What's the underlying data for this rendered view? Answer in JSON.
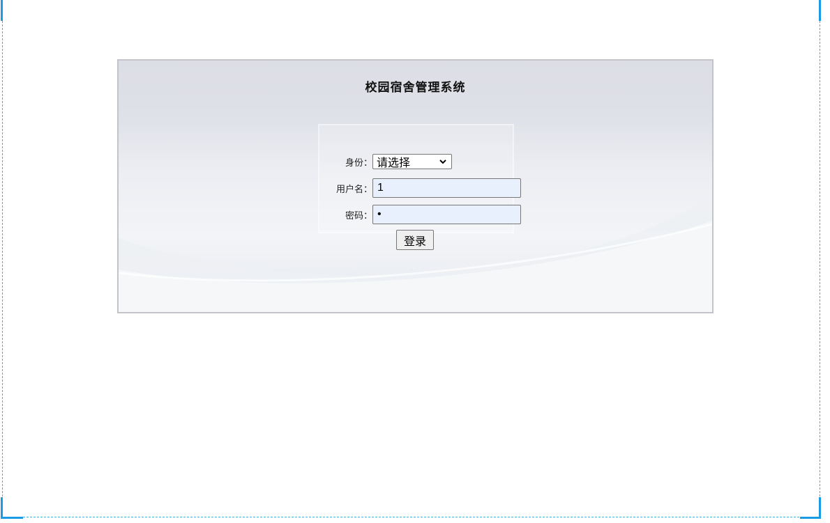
{
  "app": {
    "title": "校园宿舍管理系统"
  },
  "form": {
    "identity_label": "身份：",
    "identity_selected": "请选择",
    "username_label": "用户名：",
    "username_value": "1",
    "password_label": "密码：",
    "password_value": "•",
    "login_label": "登录"
  },
  "colors": {
    "frame_accent": "#1a9be6",
    "autofill_bg": "#e8f0fe",
    "panel_border": "#c3c4c9"
  }
}
